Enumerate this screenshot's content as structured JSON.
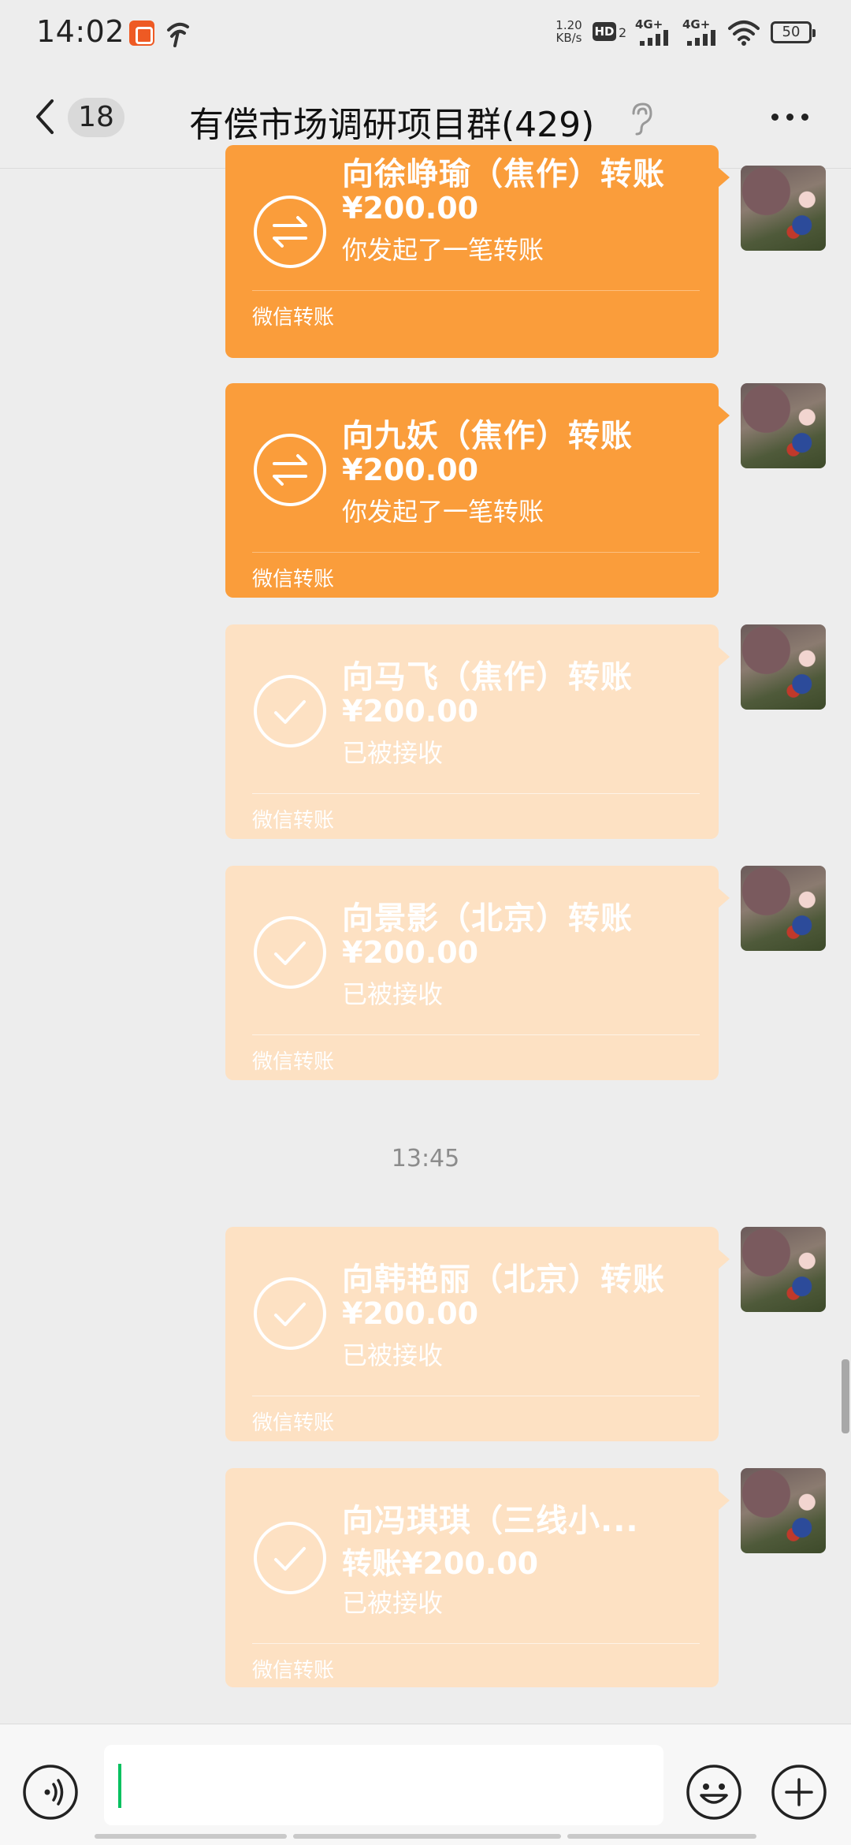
{
  "status_bar": {
    "time": "14:02",
    "net_speed_value": "1.20",
    "net_speed_unit": "KB/s",
    "hd_label": "HD",
    "hd_sim": "2",
    "sim1_label": "4G+",
    "sim2_label": "4G+",
    "battery": "50"
  },
  "header": {
    "unread_count": "18",
    "title": "有偿市场调研项目群(429)"
  },
  "messages": [
    {
      "title": "向徐峥瑜（焦作）转账",
      "amount": "¥200.00",
      "status": "你发起了一笔转账",
      "footer": "微信转账",
      "state": "pending"
    },
    {
      "title": "向九妖（焦作）转账",
      "amount": "¥200.00",
      "status": "你发起了一笔转账",
      "footer": "微信转账",
      "state": "pending"
    },
    {
      "title": "向马飞（焦作）转账",
      "amount": "¥200.00",
      "status": "已被接收",
      "footer": "微信转账",
      "state": "received"
    },
    {
      "title": "向景影（北京）转账",
      "amount": "¥200.00",
      "status": "已被接收",
      "footer": "微信转账",
      "state": "received"
    },
    {
      "title": "向韩艳丽（北京）转账",
      "amount": "¥200.00",
      "status": "已被接收",
      "footer": "微信转账",
      "state": "received"
    },
    {
      "title": "向冯琪琪（三线小...",
      "amount": "转账¥200.00",
      "status": "已被接收",
      "footer": "微信转账",
      "state": "received"
    }
  ],
  "timestamp": "13:45",
  "colors": {
    "pending_bubble": "#fa9d3b",
    "received_bubble": "#fde1c3",
    "cursor": "#07c160"
  },
  "icons": {
    "pending": "transfer-arrows-icon",
    "received": "checkmark-circle-icon"
  }
}
